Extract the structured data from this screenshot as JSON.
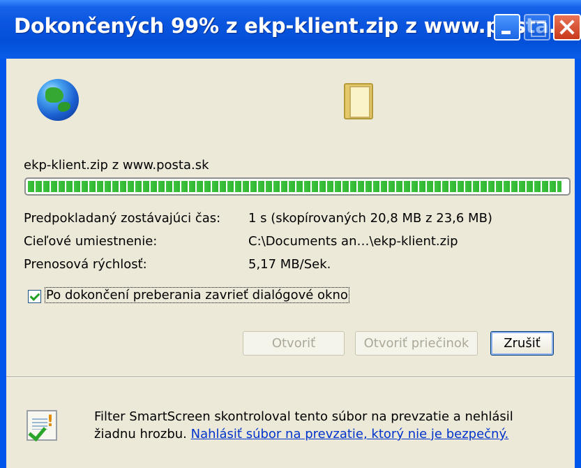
{
  "window": {
    "title": "Dokončených 99% z ekp-klient.zip z www.posta.sk",
    "controls": {
      "minimize": "minimize",
      "maximize": "maximize",
      "close": "close"
    }
  },
  "download": {
    "file_source": "ekp-klient.zip z www.posta.sk",
    "progress": 0.99,
    "accent_color": "#3ec43e"
  },
  "details": [
    {
      "label": "Predpokladaný zostávajúci čas:",
      "value": "1 s (skopírovaných 20,8 MB z 23,6 MB)"
    },
    {
      "label": "Cieľové umiestnenie:",
      "value": "C:\\Documents an…\\ekp-klient.zip"
    },
    {
      "label": "Prenosová rýchlosť:",
      "value": "5,17 MB/Sek."
    }
  ],
  "option": {
    "label": "Po dokončení preberania zavrieť dialógové okno",
    "checked": true
  },
  "buttons": {
    "open": "Otvoriť",
    "open_folder": "Otvoriť priečinok",
    "cancel": "Zrušiť"
  },
  "smartscreen": {
    "line1": "Filter SmartScreen skontroloval tento súbor na prevzatie a nehlásil",
    "line2_prefix": "žiadnu hrozbu.",
    "link": "Nahlásiť súbor na prevzatie, ktorý nie je bezpečný."
  },
  "icons": {
    "globe": "globe-icon",
    "folder": "folder-icon",
    "smartscreen": "smartscreen-shield-icon",
    "checkbox": "checkmark-icon"
  }
}
